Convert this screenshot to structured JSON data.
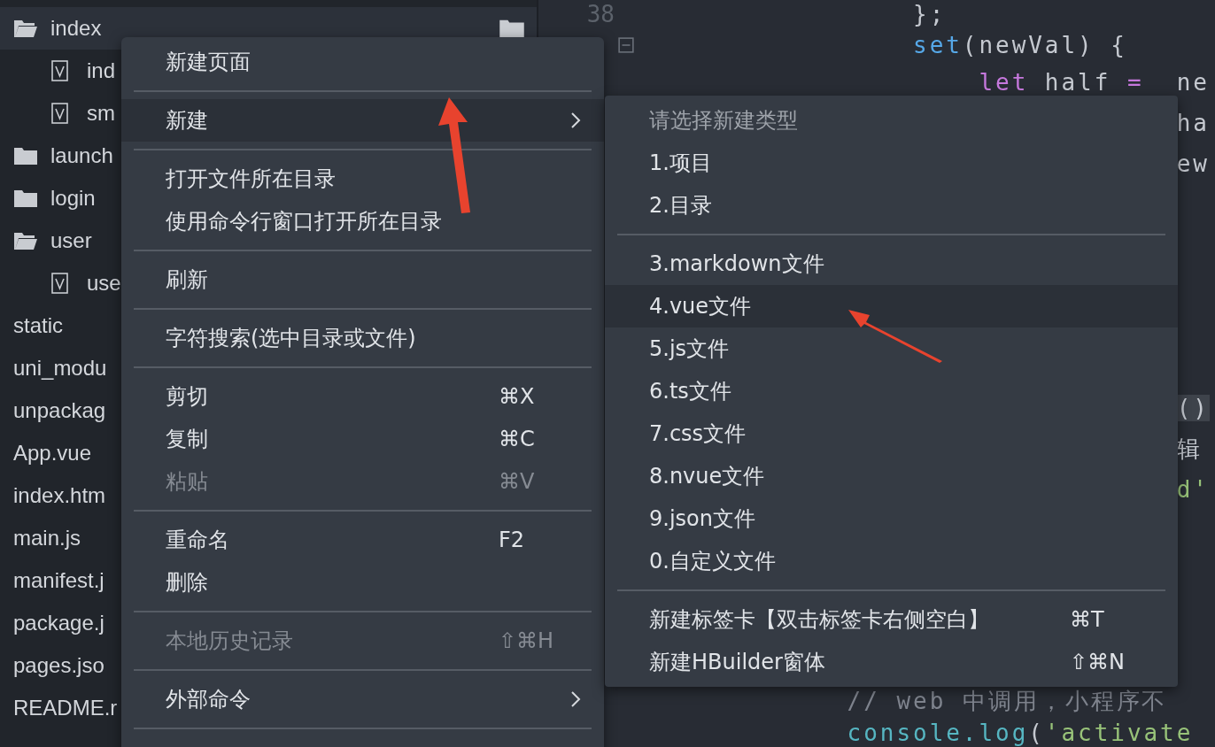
{
  "sidebar": {
    "items": [
      {
        "label": "index",
        "kind": "folder",
        "expanded": true,
        "selected": true,
        "children": [
          {
            "label": "ind",
            "kind": "vue"
          },
          {
            "label": "sm",
            "kind": "vue"
          }
        ]
      },
      {
        "label": "launch",
        "kind": "folder",
        "expanded": false,
        "selected": false
      },
      {
        "label": "login",
        "kind": "folder",
        "expanded": false,
        "selected": false
      },
      {
        "label": "user",
        "kind": "folder",
        "expanded": true,
        "selected": false,
        "children": [
          {
            "label": "use",
            "kind": "vue"
          }
        ]
      },
      {
        "label": "static",
        "kind": "file",
        "selected": false
      },
      {
        "label": "uni_modu",
        "kind": "file",
        "selected": false
      },
      {
        "label": "unpackag",
        "kind": "file",
        "selected": false
      },
      {
        "label": "App.vue",
        "kind": "file",
        "selected": false
      },
      {
        "label": "index.htm",
        "kind": "file",
        "selected": false
      },
      {
        "label": "main.js",
        "kind": "file",
        "selected": false
      },
      {
        "label": "manifest.j",
        "kind": "file",
        "selected": false
      },
      {
        "label": "package.j",
        "kind": "file",
        "selected": false
      },
      {
        "label": "pages.jso",
        "kind": "file",
        "selected": false
      },
      {
        "label": "README.r",
        "kind": "file",
        "selected": false
      }
    ]
  },
  "editor": {
    "line_number": "38",
    "lines": [
      {
        "kind": "code",
        "tokens": [
          {
            "text": "    };",
            "kind": "plain"
          }
        ]
      },
      {
        "kind": "code",
        "fold": true,
        "tokens": [
          {
            "text": "    set",
            "kind": "function"
          },
          {
            "text": "(newVal) {",
            "kind": "plain"
          }
        ]
      },
      {
        "kind": "code",
        "tokens": [
          {
            "text": "        let",
            "kind": "keyword"
          },
          {
            "text": " half ",
            "kind": "plain"
          },
          {
            "text": "=",
            "kind": "keyword"
          },
          {
            "text": "  ne",
            "kind": "plain"
          }
        ]
      },
      {
        "kind": "code",
        "tokens": [
          {
            "text": "                    ha",
            "kind": "plain"
          }
        ]
      },
      {
        "kind": "code",
        "tokens": [
          {
            "text": "                    ew",
            "kind": "plain"
          }
        ]
      },
      {
        "kind": "blank"
      },
      {
        "kind": "blank"
      },
      {
        "kind": "blank"
      },
      {
        "kind": "blank"
      },
      {
        "kind": "blank"
      },
      {
        "kind": "code",
        "tokens": [
          {
            "text": "                    ()",
            "kind": "match"
          }
        ]
      },
      {
        "kind": "code",
        "tokens": [
          {
            "text": "                    辑",
            "kind": "plain"
          }
        ]
      },
      {
        "kind": "code",
        "tokens": [
          {
            "text": "                    d'",
            "kind": "string"
          }
        ]
      },
      {
        "kind": "blank"
      },
      {
        "kind": "blank"
      },
      {
        "kind": "blank"
      },
      {
        "kind": "blank"
      },
      {
        "kind": "code",
        "tokens": [
          {
            "text": "// web 中调用，小程序不",
            "kind": "comment"
          }
        ]
      },
      {
        "kind": "code",
        "tokens": [
          {
            "text": "console.log",
            "kind": "object"
          },
          {
            "text": "(",
            "kind": "plain"
          },
          {
            "text": "'activate",
            "kind": "string"
          }
        ]
      }
    ]
  },
  "context_menu": {
    "items": [
      {
        "kind": "item",
        "label": "新建页面",
        "disabled": false,
        "selected": false
      },
      {
        "kind": "separator"
      },
      {
        "kind": "item",
        "label": "新建",
        "has_submenu": true,
        "disabled": false,
        "selected": true
      },
      {
        "kind": "separator"
      },
      {
        "kind": "item",
        "label": "打开文件所在目录",
        "disabled": false,
        "selected": false
      },
      {
        "kind": "item",
        "label": "使用命令行窗口打开所在目录",
        "disabled": false,
        "selected": false
      },
      {
        "kind": "separator"
      },
      {
        "kind": "item",
        "label": "刷新",
        "disabled": false,
        "selected": false
      },
      {
        "kind": "separator"
      },
      {
        "kind": "item",
        "label": "字符搜索(选中目录或文件)",
        "disabled": false,
        "selected": false
      },
      {
        "kind": "separator"
      },
      {
        "kind": "item",
        "label": "剪切",
        "shortcut": "⌘X",
        "disabled": false,
        "selected": false
      },
      {
        "kind": "item",
        "label": "复制",
        "shortcut": "⌘C",
        "disabled": false,
        "selected": false
      },
      {
        "kind": "item",
        "label": "粘贴",
        "shortcut": "⌘V",
        "disabled": true,
        "selected": false
      },
      {
        "kind": "separator"
      },
      {
        "kind": "item",
        "label": "重命名",
        "shortcut": "F2",
        "disabled": false,
        "selected": false
      },
      {
        "kind": "item",
        "label": "删除",
        "disabled": false,
        "selected": false
      },
      {
        "kind": "separator"
      },
      {
        "kind": "item",
        "label": "本地历史记录",
        "shortcut": "⇧⌘H",
        "disabled": true,
        "selected": false
      },
      {
        "kind": "separator"
      },
      {
        "kind": "item",
        "label": "外部命令",
        "has_submenu": true,
        "disabled": false,
        "selected": false
      },
      {
        "kind": "separator"
      }
    ]
  },
  "submenu": {
    "items": [
      {
        "kind": "header",
        "label": "请选择新建类型"
      },
      {
        "kind": "item",
        "label": "1.项目",
        "selected": false
      },
      {
        "kind": "item",
        "label": "2.目录",
        "selected": false
      },
      {
        "kind": "separator"
      },
      {
        "kind": "item",
        "label": "3.markdown文件",
        "selected": false
      },
      {
        "kind": "item",
        "label": "4.vue文件",
        "selected": true
      },
      {
        "kind": "item",
        "label": "5.js文件",
        "selected": false
      },
      {
        "kind": "item",
        "label": "6.ts文件",
        "selected": false
      },
      {
        "kind": "item",
        "label": "7.css文件",
        "selected": false
      },
      {
        "kind": "item",
        "label": "8.nvue文件",
        "selected": false
      },
      {
        "kind": "item",
        "label": "9.json文件",
        "selected": false
      },
      {
        "kind": "item",
        "label": "0.自定义文件",
        "selected": false
      },
      {
        "kind": "separator"
      },
      {
        "kind": "item",
        "label": "新建标签卡【双击标签卡右侧空白】",
        "shortcut": "⌘T",
        "selected": false
      },
      {
        "kind": "item",
        "label": "新建HBuilder窗体",
        "shortcut": "⇧⌘N",
        "selected": false
      }
    ]
  }
}
